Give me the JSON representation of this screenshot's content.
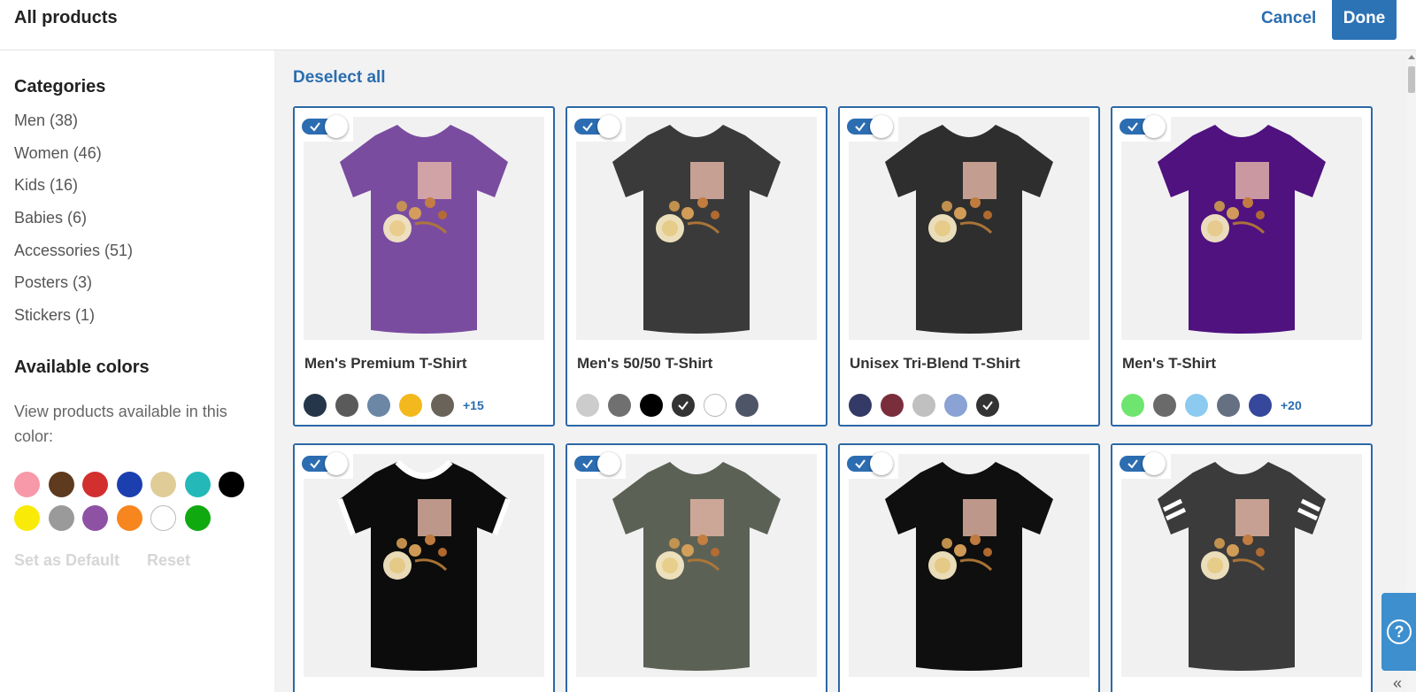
{
  "header": {
    "title": "All products",
    "cancel_label": "Cancel",
    "done_label": "Done"
  },
  "sidebar": {
    "categories_title": "Categories",
    "categories": [
      {
        "label": "Men (38)"
      },
      {
        "label": "Women (46)"
      },
      {
        "label": "Kids (16)"
      },
      {
        "label": "Babies (6)"
      },
      {
        "label": "Accessories (51)"
      },
      {
        "label": "Posters (3)"
      },
      {
        "label": "Stickers (1)"
      }
    ],
    "colors_title": "Available colors",
    "colors_text": "View products available in this color:",
    "swatches": [
      "#f799a9",
      "#5e3a1f",
      "#d22f2f",
      "#1b3fae",
      "#dfcc97",
      "#24b8b8",
      "#000000",
      "#f9ea08",
      "#9a9a9a",
      "#8e52a4",
      "#f7861e",
      "#ffffff",
      "#10aa10"
    ],
    "set_default_label": "Set as Default",
    "reset_label": "Reset"
  },
  "main": {
    "deselect_label": "Deselect all",
    "products": [
      {
        "name": "Men's Premium T-Shirt",
        "shirt_color": "#7a4ca0",
        "shirt_style": "plain",
        "colors": [
          "#26364a",
          "#5a5a5a",
          "#6b87a5",
          "#f3b81d",
          "#6a635a"
        ],
        "more": "+15",
        "selected_color": -1
      },
      {
        "name": "Men's 50/50 T-Shirt",
        "shirt_color": "#3a3a3a",
        "shirt_style": "plain",
        "colors": [
          "#cccccc",
          "#707070",
          "#000000",
          "#333333",
          "#ffffff",
          "#4d5567"
        ],
        "more": "",
        "selected_color": 3
      },
      {
        "name": "Unisex Tri-Blend T-Shirt",
        "shirt_color": "#2e2e2e",
        "shirt_style": "plain",
        "colors": [
          "#333a66",
          "#7a2e3c",
          "#c0c0c0",
          "#8aa2d4",
          "#333333"
        ],
        "more": "",
        "selected_color": 4
      },
      {
        "name": "Men's T-Shirt",
        "shirt_color": "#4f127f",
        "shirt_style": "plain",
        "colors": [
          "#6ee56e",
          "#6a6a6a",
          "#8ccbef",
          "#657083",
          "#36489b"
        ],
        "more": "+20",
        "selected_color": -1
      },
      {
        "name": "",
        "shirt_color": "#0c0c0c",
        "shirt_style": "ringer",
        "colors": [],
        "more": "",
        "selected_color": -1
      },
      {
        "name": "",
        "shirt_color": "#5c6155",
        "shirt_style": "plain",
        "colors": [],
        "more": "",
        "selected_color": -1
      },
      {
        "name": "",
        "shirt_color": "#0f0f0f",
        "shirt_style": "plain",
        "colors": [],
        "more": "",
        "selected_color": -1
      },
      {
        "name": "",
        "shirt_color": "#3b3b3b",
        "shirt_style": "stripes",
        "colors": [],
        "more": "",
        "selected_color": -1
      }
    ]
  },
  "help": {
    "icon_label": "?",
    "collapse_label": "«"
  }
}
